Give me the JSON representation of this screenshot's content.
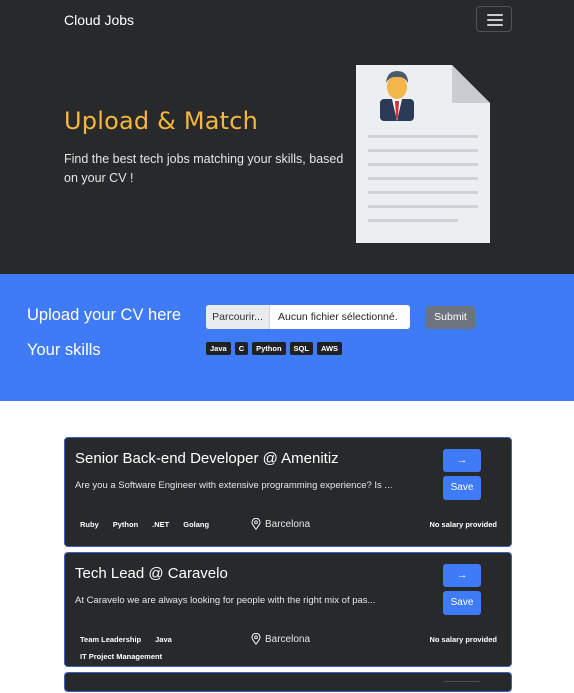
{
  "navbar": {
    "brand": "Cloud Jobs"
  },
  "hero": {
    "title": "Upload & Match",
    "subtitle": "Find the best tech jobs matching your skills, based on your CV !"
  },
  "upload": {
    "label": "Upload your CV here",
    "browse_label": "Parcourir...",
    "file_status": "Aucun fichier sélectionné.",
    "submit_label": "Submit",
    "skills_label": "Your skills",
    "skills": [
      "Java",
      "C",
      "Python",
      "SQL",
      "AWS"
    ]
  },
  "jobs": [
    {
      "title": "Senior Back-end Developer @ Amenitiz",
      "description": "Are you a Software Engineer with extensive programming experience? Is ...",
      "tags": [
        "Ruby",
        "Python",
        ".NET",
        "Golang"
      ],
      "location": "Barcelona",
      "salary": "No salary provided",
      "go_label": "→",
      "save_label": "Save"
    },
    {
      "title": "Tech Lead @ Caravelo",
      "description": "At Caravelo we are always looking for people with the right mix of pas...",
      "tags": [
        "Team Leadership",
        "Java",
        "IT Project Management"
      ],
      "location": "Barcelona",
      "salary": "No salary provided",
      "go_label": "→",
      "save_label": "Save"
    }
  ],
  "icons": {
    "menu": "hamburger-menu-icon",
    "location": "map-pin-icon",
    "illustration": "cv-document-illustration"
  },
  "colors": {
    "accent": "#3f7bf6",
    "title": "#f4b73f",
    "dark_bg": "#27292b"
  }
}
